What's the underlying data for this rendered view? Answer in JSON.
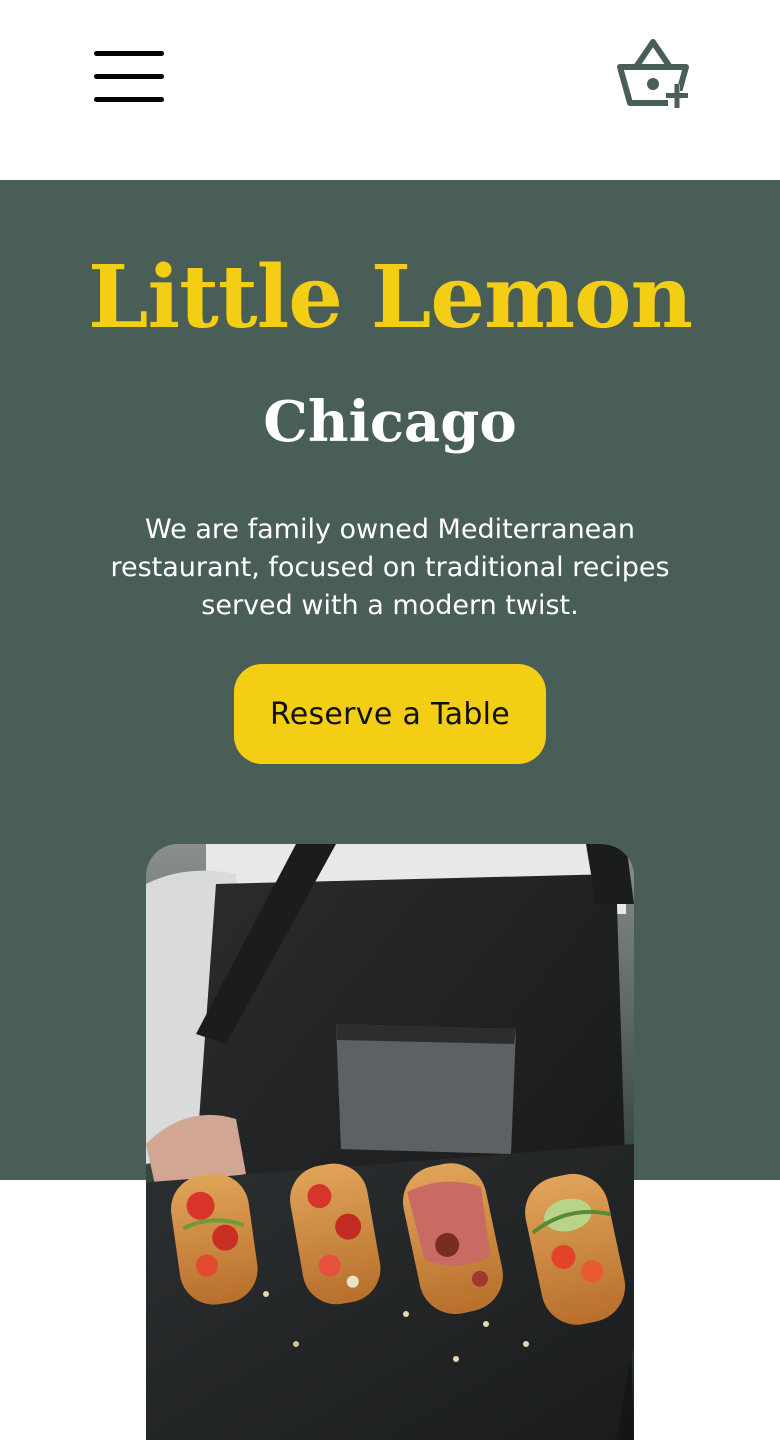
{
  "header": {
    "menu_icon": "hamburger-menu-icon",
    "cart_icon": "basket-add-icon"
  },
  "hero": {
    "title": "Little Lemon",
    "subtitle": "Chicago",
    "description": "We are family owned Mediterranean restaurant, focused on traditional recipes served with a modern twist.",
    "reserve_button_label": "Reserve a Table",
    "image_subject": "chef holding slate board with bruschetta"
  },
  "colors": {
    "primary_green": "#495e57",
    "primary_yellow": "#f4ce14",
    "white": "#ffffff",
    "black": "#000000"
  }
}
